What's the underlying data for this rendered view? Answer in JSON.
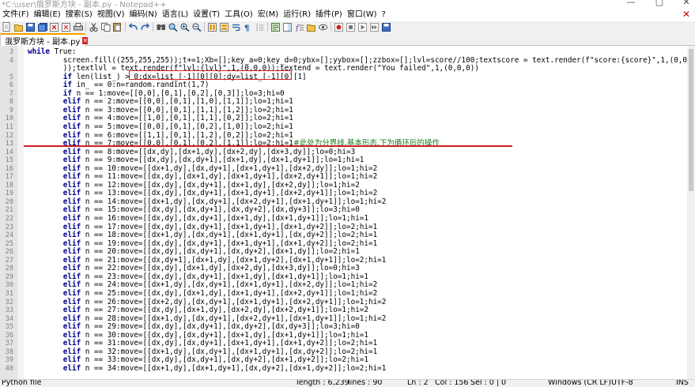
{
  "window": {
    "title": "*C:\\user\\俄罗斯方块 - 副本.py - Notepad++",
    "minimize": "—",
    "maximize": "▢",
    "close": "✕"
  },
  "menu": {
    "items": [
      "文件(F)",
      "编辑(E)",
      "搜索(S)",
      "视图(V)",
      "编码(N)",
      "语言(L)",
      "设置(T)",
      "工具(O)",
      "宏(M)",
      "运行(R)",
      "插件(P)",
      "窗口(W)",
      "?"
    ],
    "close_doc": "✕"
  },
  "toolbar": {
    "icons": [
      "new-icon",
      "open-icon",
      "save-icon",
      "save-all-icon",
      "close-icon",
      "close-all-icon",
      "print-icon",
      "cut-icon",
      "copy-icon",
      "paste-icon",
      "undo-icon",
      "redo-icon",
      "find-icon",
      "replace-icon",
      "zoom-in-icon",
      "zoom-out-icon",
      "sync-v-icon",
      "sync-h-icon",
      "wrap-icon",
      "all-chars-icon",
      "indent-guide-icon",
      "udl-icon",
      "doc-map-icon",
      "function-list-icon",
      "folder-workspace-icon",
      "monitor-icon",
      "record-icon",
      "stop-icon",
      "play-icon",
      "play-multi-icon",
      "save-macro-icon"
    ]
  },
  "tab": {
    "label": "俄罗斯方块 - 副本.py",
    "close": "✕"
  },
  "editor": {
    "lines": [
      {
        "n": "3",
        "t": "while True:"
      },
      {
        "n": "4",
        "t": "        screen.fill((255,255,255));t+=1;Xb=[];key_a=0;key_d=0;ybx=[];yybox=[];zzbox=[];lvl=score//100;textscore = text.render(f\"score:{score}\",1,(0,0,0"
      },
      {
        "n": "",
        "t": "        ));textlvl = text.render(f\"lvl:{lvl}\",1,(0,0,0));textend = text.render(\"You failed\",1,(0,0,0))"
      },
      {
        "n": "5",
        "t": "        if len(list_) > 0:dx=list_[-1][0][0];dy=list_[-1][0][1]"
      },
      {
        "n": "6",
        "t": "        if in_ == 0:n=random.randint(1,7)"
      },
      {
        "n": "7",
        "t": "        if n == 1:move=[[0,0],[0,1],[0,2],[0,3]];lo=3;hi=0"
      },
      {
        "n": "8",
        "t": "        elif n == 2:move=[[0,0],[0,1],[1,0],[1,1]];lo=1;hi=1"
      },
      {
        "n": "9",
        "t": "        elif n == 3:move=[[0,0],[0,1],[1,1],[1,2]];lo=2;hi=1"
      },
      {
        "n": "10",
        "t": "        elif n == 4:move=[[1,0],[0,1],[1,1],[0,2]];lo=2;hi=1"
      },
      {
        "n": "11",
        "t": "        elif n == 5:move=[[0,0],[0,1],[0,2],[1,0]];lo=2;hi=1"
      },
      {
        "n": "12",
        "t": "        elif n == 6:move=[[1,1],[0,1],[1,2],[0,2]];lo=2;hi=1"
      },
      {
        "n": "13",
        "t": "        elif n == 7:move=[[0,0],[0,1],[0,2],[1,1]];lo=2;hi=1"
      },
      {
        "n": "14",
        "t": "        elif n == 8:move=[[dx,dy],[dx+1,dy],[dx+2,dy],[dx+3,dy]];lo=0;hi=3"
      },
      {
        "n": "15",
        "t": "        elif n == 9:move=[[dx,dy],[dx,dy+1],[dx+1,dy],[dx+1,dy+1]];lo=1;hi=1"
      },
      {
        "n": "16",
        "t": "        elif n == 10:move=[[dx+1,dy],[dx,dy+1],[dx+1,dy+1],[dx+2,dy]];lo=1;hi=2"
      },
      {
        "n": "17",
        "t": "        elif n == 11:move=[[dx,dy],[dx+1,dy],[dx+1,dy+1],[dx+2,dy+1]];lo=1;hi=2"
      },
      {
        "n": "18",
        "t": "        elif n == 12:move=[[dx,dy],[dx,dy+1],[dx+1,dy],[dx+2,dy]];lo=1;hi=2"
      },
      {
        "n": "19",
        "t": "        elif n == 13:move=[[dx,dy],[dx,dy+1],[dx+1,dy+1],[dx+2,dy+1]];lo=1;hi=2"
      },
      {
        "n": "20",
        "t": "        elif n == 14:move=[[dx+1,dy],[dx,dy+1],[dx+2,dy+1],[dx+1,dy+1]];lo=1;hi=2"
      },
      {
        "n": "21",
        "t": "        elif n == 15:move=[[dx,dy],[dx,dy+1],[dx,dy+2],[dx,dy+3]];lo=3;hi=0"
      },
      {
        "n": "22",
        "t": "        elif n == 16:move=[[dx,dy],[dx,dy+1],[dx+1,dy],[dx+1,dy+1]];lo=1;hi=1"
      },
      {
        "n": "23",
        "t": "        elif n == 17:move=[[dx,dy],[dx,dy+1],[dx+1,dy+1],[dx+1,dy+2]];lo=2;hi=1"
      },
      {
        "n": "24",
        "t": "        elif n == 18:move=[[dx+1,dy],[dx,dy+1],[dx+1,dy+1],[dx,dy+2]];lo=2;hi=1"
      },
      {
        "n": "25",
        "t": "        elif n == 19:move=[[dx,dy],[dx,dy+1],[dx+1,dy+1],[dx+1,dy+2]];lo=2;hi=1"
      },
      {
        "n": "26",
        "t": "        elif n == 20:move=[[dx,dy],[dx,dy+1],[dx,dy+2],[dx+1,dy]];lo=2;hi=1"
      },
      {
        "n": "27",
        "t": "        elif n == 21:move=[[dx,dy+1],[dx+1,dy],[dx+1,dy+2],[dx+1,dy+1]];lo=2;hi=1"
      },
      {
        "n": "28",
        "t": "        elif n == 22:move=[[dx,dy],[dx+1,dy],[dx+2,dy],[dx+3,dy]];lo=0;hi=3"
      },
      {
        "n": "29",
        "t": "        elif n == 23:move=[[dx,dy],[dx,dy+1],[dx+1,dy],[dx+1,dy+1]];lo=1;hi=1"
      },
      {
        "n": "30",
        "t": "        elif n == 24:move=[[dx+1,dy],[dx,dy+1],[dx+1,dy+1],[dx+2,dy]];lo=1;hi=2"
      },
      {
        "n": "31",
        "t": "        elif n == 25:move=[[dx,dy],[dx+1,dy],[dx+1,dy+1],[dx+2,dy+1]];lo=1;hi=2"
      },
      {
        "n": "32",
        "t": "        elif n == 26:move=[[dx+2,dy],[dx,dy+1],[dx+1,dy+1],[dx+2,dy+1]];lo=1;hi=2"
      },
      {
        "n": "33",
        "t": "        elif n == 27:move=[[dx,dy],[dx+1,dy],[dx+2,dy],[dx+2,dy+1]];lo=1;hi=2"
      },
      {
        "n": "34",
        "t": "        elif n == 28:move=[[dx+1,dy],[dx,dy+1],[dx+2,dy+1],[dx+1,dy+1]];lo=1;hi=2"
      },
      {
        "n": "35",
        "t": "        elif n == 29:move=[[dx,dy],[dx,dy+1],[dx,dy+2],[dx,dy+3]];lo=3;hi=0"
      },
      {
        "n": "36",
        "t": "        elif n == 30:move=[[dx,dy],[dx,dy+1],[dx+1,dy],[dx+1,dy+1]];lo=1;hi=1"
      },
      {
        "n": "37",
        "t": "        elif n == 31:move=[[dx,dy],[dx,dy+1],[dx+1,dy+1],[dx+1,dy+2]];lo=2;hi=1"
      },
      {
        "n": "38",
        "t": "        elif n == 32:move=[[dx+1,dy],[dx,dy+1],[dx+1,dy+1],[dx,dy+2]];lo=2;hi=1"
      },
      {
        "n": "39",
        "t": "        elif n == 33:move=[[dx,dy],[dx,dy+1],[dx,dy+2],[dx+1,dy+2]];lo=2;hi=1"
      },
      {
        "n": "40",
        "t": "        elif n == 34:move=[[dx+1,dy],[dx+1,dy+1],[dx,dy+2],[dx+1,dy+2]];lo=2;hi=1"
      }
    ],
    "annotation": "#此处为分界线,基本形态,下为循环后的操作"
  },
  "status": {
    "filetype": "Python file",
    "length": "length : 6,239",
    "lines": "lines : 90",
    "ln": "Ln : 2",
    "col": "Col : 156",
    "sel": "Sel : 0 | 0",
    "eol": "Windows (CR LF)",
    "encoding": "UTF-8",
    "mode": "INS"
  },
  "colors": {
    "keyword": "#00008b",
    "highlight_box": "#d02020",
    "annotation": "#1a7a1a",
    "tab_accent": "#f5a000"
  }
}
